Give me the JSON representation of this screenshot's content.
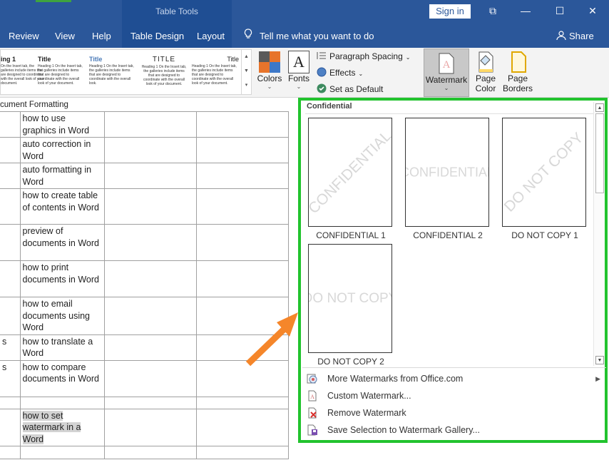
{
  "titlebar": {
    "context_group": "Table Tools",
    "sign_in": "Sign in",
    "window_buttons": [
      "⧉",
      "—",
      "☐",
      "✕"
    ]
  },
  "tabs": [
    "Review",
    "View",
    "Help",
    "Table Design",
    "Layout"
  ],
  "tell_me": "Tell me what you want to do",
  "share": "Share",
  "ribbon": {
    "style_gallery": [
      {
        "title": "ing 1",
        "sub": "On the Insert tab, the galleries include items that are designed to coordinate with the overall look of your document."
      },
      {
        "title": "Title",
        "sub": "Heading 1 On the Insert tab, the galleries include items that are designed to coordinate with the overall look of your document."
      },
      {
        "title": "Title",
        "sub": "Heading 1 On the Insert tab, the galleries include items that are designed to coordinate with the overall look."
      },
      {
        "title": "TITLE",
        "sub": "Heading 1 On the Insert tab, the galleries include items that are designed to coordinate with the overall look of your document."
      },
      {
        "title": "Title",
        "sub": "Heading 1 On the Insert tab, the galleries include items that are designed to coordinate with the overall look of your document."
      }
    ],
    "colors": "Colors",
    "fonts": "Fonts",
    "paragraph_spacing": "Paragraph Spacing",
    "effects": "Effects",
    "set_default": "Set as Default",
    "watermark": "Watermark",
    "page_color_1": "Page",
    "page_color_2": "Color",
    "page_borders_1": "Page",
    "page_borders_2": "Borders"
  },
  "document": {
    "header": "cument Formatting",
    "rows": [
      {
        "c0": "",
        "c1": "how to use graphics in Word"
      },
      {
        "c0": "",
        "c1": "auto correction in Word"
      },
      {
        "c0": "",
        "c1": "auto formatting in Word"
      },
      {
        "c0": "",
        "c1": "how to create table of contents in Word"
      },
      {
        "c0": "",
        "c1": " preview of documents in Word"
      },
      {
        "c0": "",
        "c1": "how to print documents in Word"
      },
      {
        "c0": "",
        "c1": "how to email documents using Word"
      },
      {
        "c0": "s",
        "c1": "how to translate a Word"
      },
      {
        "c0": "s",
        "c1": " how to compare documents in Word"
      },
      {
        "c0": "",
        "c1": ""
      },
      {
        "c0": "",
        "c1": "how to set watermark in a Word"
      },
      {
        "c0": "",
        "c1": ""
      }
    ]
  },
  "panel": {
    "section_title": "Confidential",
    "watermarks": [
      {
        "caption": "CONFIDENTIAL 1",
        "text": "CONFIDENTIAL"
      },
      {
        "caption": "CONFIDENTIAL 2",
        "text": "CONFIDENTIAL"
      },
      {
        "caption": "DO NOT COPY 1",
        "text": "DO NOT COPY"
      },
      {
        "caption": "DO NOT COPY 2",
        "text": "DO NOT COPY"
      }
    ],
    "menu": [
      {
        "label": "More Watermarks from Office.com",
        "icon": "office-watermark-icon",
        "has_submenu": true
      },
      {
        "label": "Custom Watermark...",
        "icon": "custom-watermark-icon",
        "has_submenu": false
      },
      {
        "label": "Remove Watermark",
        "icon": "remove-watermark-icon",
        "has_submenu": false
      },
      {
        "label": "Save Selection to Watermark Gallery...",
        "icon": "save-watermark-icon",
        "has_submenu": false
      }
    ]
  },
  "colors": {
    "title_bar": "#2b579a",
    "highlight_border": "#22c32e",
    "arrow": "#f5862a"
  }
}
